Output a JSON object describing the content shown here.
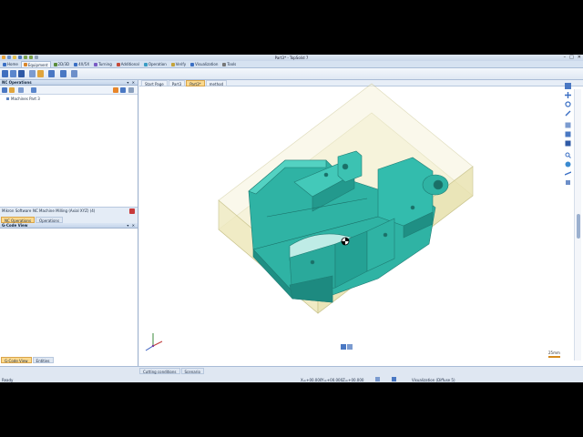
{
  "app": {
    "title": "Part3* - TopSolid 7"
  },
  "menu": [
    {
      "label": "Home",
      "color": "#3a6fc4"
    },
    {
      "label": "Equipment",
      "color": "#d9862a",
      "active": true
    },
    {
      "label": "2D/3D",
      "color": "#5a8c3c"
    },
    {
      "label": "4X/5X",
      "color": "#3a6fc4"
    },
    {
      "label": "Turning",
      "color": "#7a5cc4"
    },
    {
      "label": "Additional",
      "color": "#c44a3a"
    },
    {
      "label": "Operation",
      "color": "#3a9cc4"
    },
    {
      "label": "Verify",
      "color": "#c4a33a"
    },
    {
      "label": "Visualization",
      "color": "#3a6fc4"
    },
    {
      "label": "Tools",
      "color": "#777777"
    }
  ],
  "left_panel": {
    "title": "NC Operations",
    "controls": "▾ ✕",
    "tree_root": "Machines Part 3",
    "machine_info": [
      "Mikron Software",
      "NC Machine Milling (Axial XYZ) (4)"
    ],
    "tabs": [
      "NC Operations",
      "Operations"
    ],
    "gcode_title": "G-Code View",
    "bottom_tabs": [
      "G-Code View",
      "Entities"
    ]
  },
  "doc_tabs": [
    "Start Page",
    "Part3",
    "Part3*",
    "method"
  ],
  "viewport": {
    "zoom_label": "25mm"
  },
  "status": {
    "ready": "Ready",
    "tabs": [
      "Cutting conditions",
      "Scenario"
    ],
    "x": "X=+00.000",
    "y": "Y=+00.000",
    "z": "Z=+00.000",
    "visualization": "Visualization (Diffuse 5)"
  },
  "colors": {
    "accent": "#f0a030",
    "part": "#39c4b4",
    "stock": "#f3f0cf"
  }
}
